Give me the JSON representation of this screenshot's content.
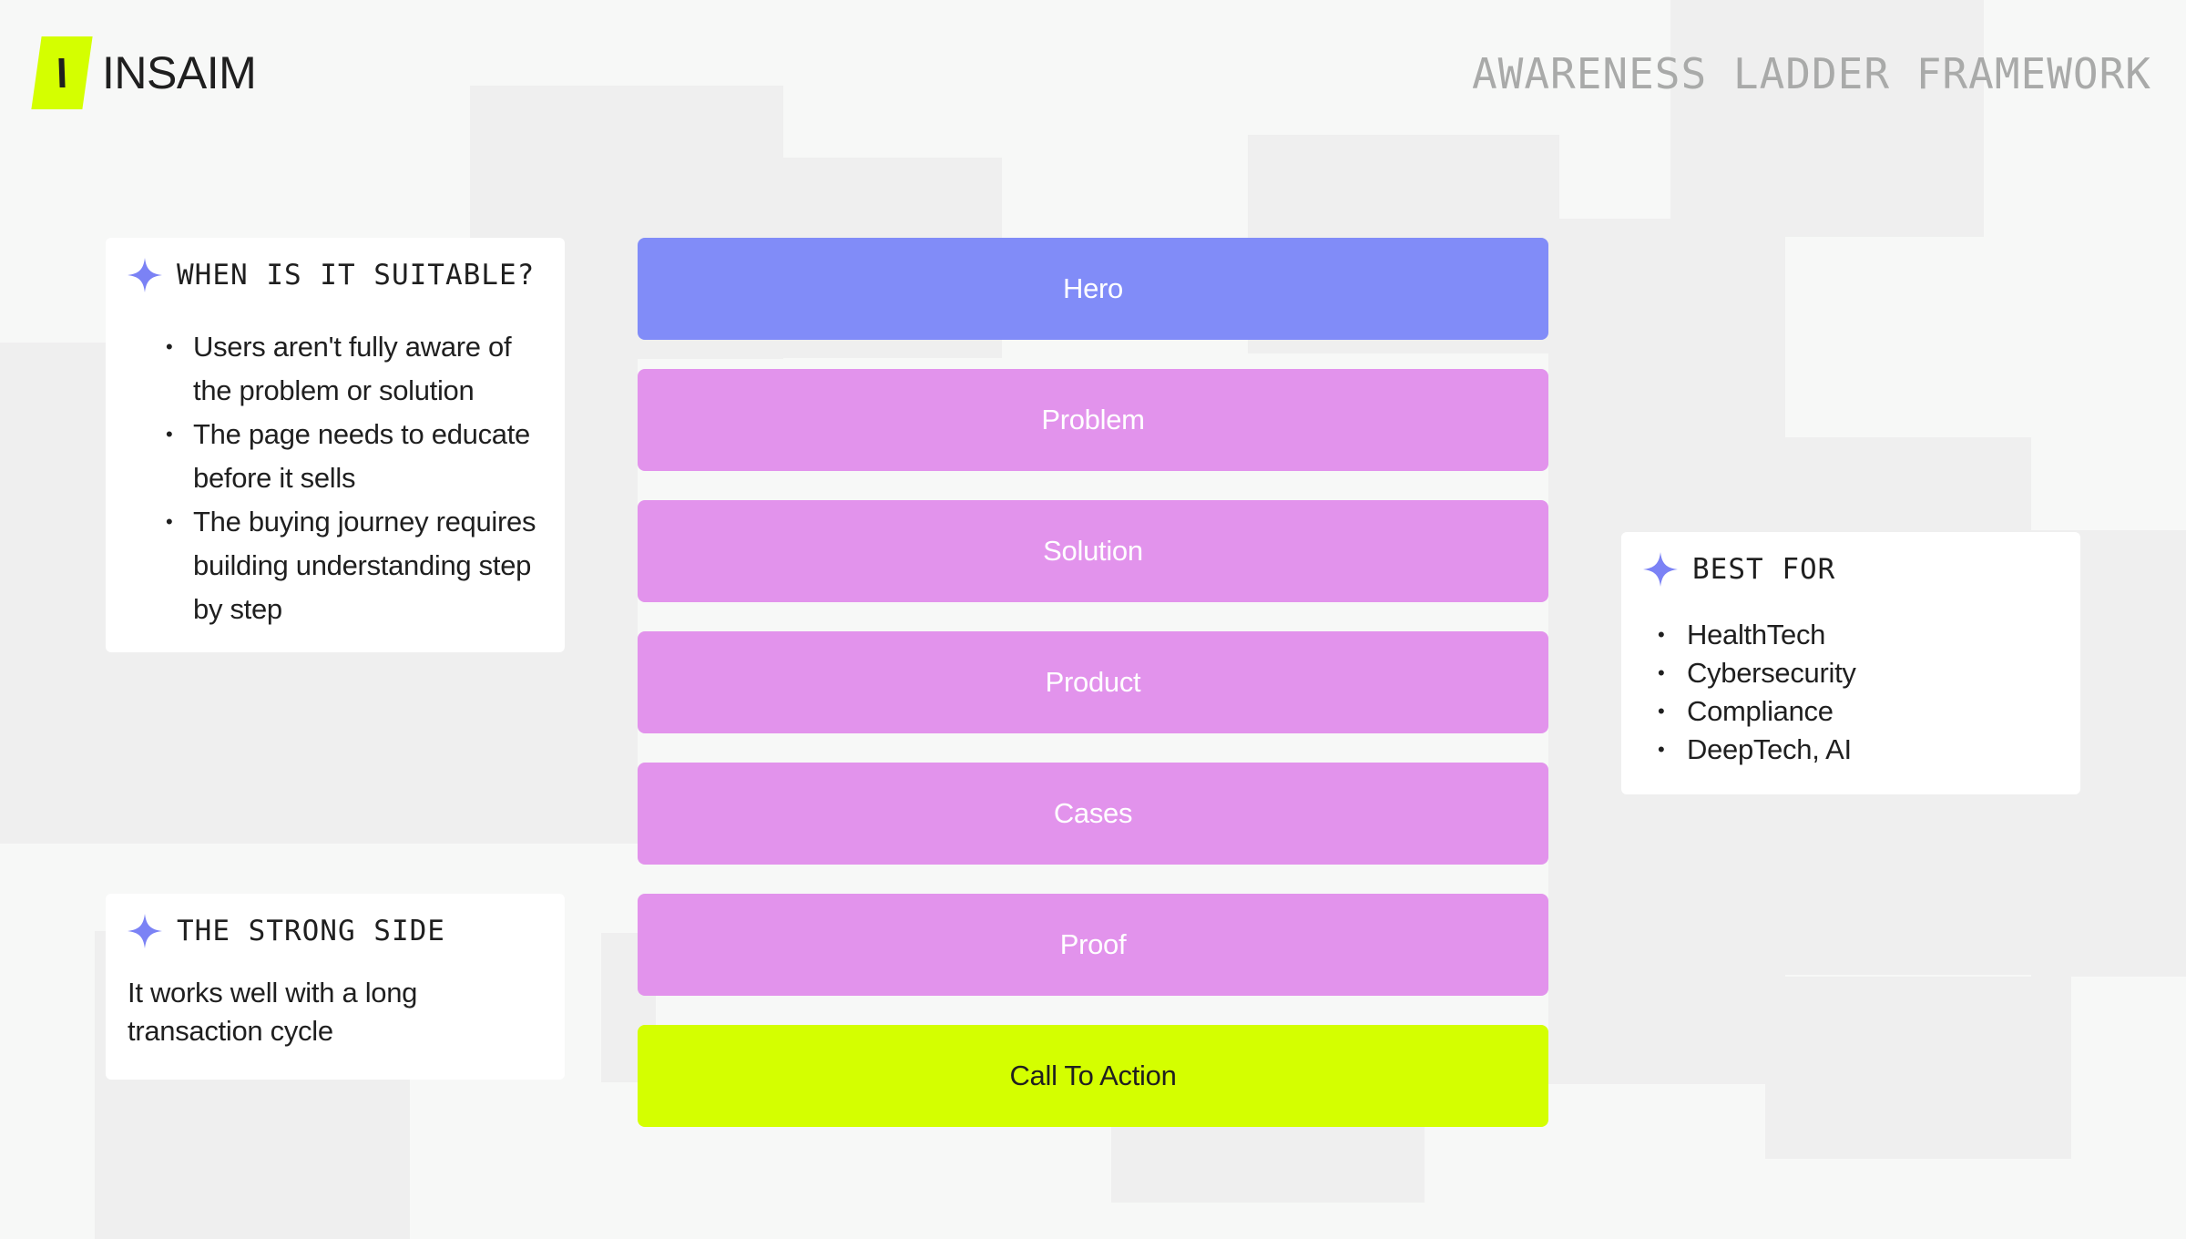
{
  "brand": {
    "name": "INSAIM",
    "accent": "#d4ff00"
  },
  "page_title": "AWARENESS LADDER FRAMEWORK",
  "colors": {
    "hero": "#818cf8",
    "stage": "#e293ec",
    "cta": "#d4ff00",
    "sparkle": "#7b82f5"
  },
  "ladder": {
    "steps": [
      {
        "label": "Hero",
        "kind": "hero"
      },
      {
        "label": "Problem",
        "kind": "stage"
      },
      {
        "label": "Solution",
        "kind": "stage"
      },
      {
        "label": "Product",
        "kind": "stage"
      },
      {
        "label": "Cases",
        "kind": "stage"
      },
      {
        "label": "Proof",
        "kind": "stage"
      },
      {
        "label": "Call To Action",
        "kind": "cta"
      }
    ]
  },
  "when_suitable": {
    "title": "WHEN IS IT SUITABLE?",
    "icon": "sparkle-icon",
    "items": [
      "Users aren't fully aware of the problem or solution",
      "The page needs to educate before it sells",
      "The buying journey requires building understanding step by step"
    ]
  },
  "strong_side": {
    "title": "THE STRONG SIDE",
    "icon": "sparkle-icon",
    "text": "It works well with a long transaction cycle"
  },
  "best_for": {
    "title": "BEST FOR",
    "icon": "sparkle-icon",
    "items": [
      "HealthTech",
      "Cybersecurity",
      "Compliance",
      "DeepTech, AI"
    ]
  }
}
